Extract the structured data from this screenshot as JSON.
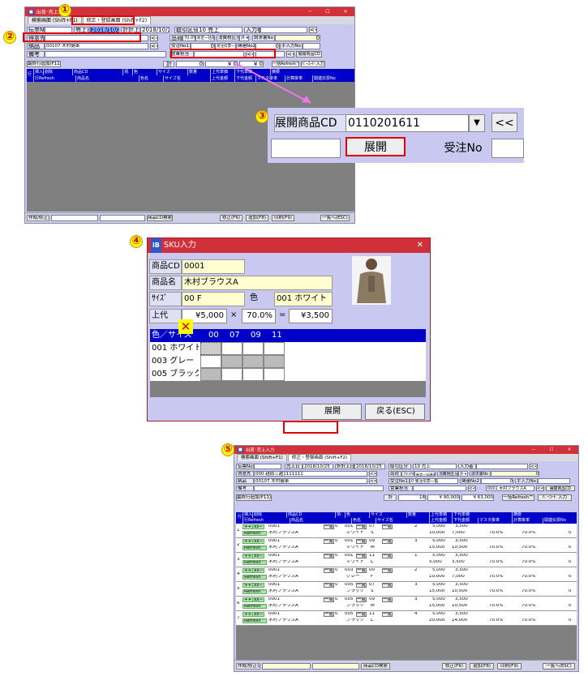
{
  "markers": [
    "①",
    "②",
    "③",
    "④",
    "⑤"
  ],
  "win1": {
    "title": "出荷･売上入力",
    "tabs": [
      "検索画面 (Shift+F1)",
      "修正・登録画面 (Shift+F2)"
    ],
    "fields": {
      "denpyo": "伝票No",
      "uriage_label": "売上日",
      "uriage_val": "2018/10/25",
      "keijo_label": "計計上日",
      "keijo_val": "2018/10/25",
      "torihiki_label": "取引区分",
      "torihiki_val": "10 売上",
      "nyuryoku": "入力者",
      "tokuisaki": "得意先",
      "shukka": "出荷",
      "rate": "70.0%",
      "rate_note": "新定一括基準",
      "shohizei": "消費税区分",
      "shohizei_val": "外 ▾",
      "seikyu": "請求書No",
      "nohin": "納品",
      "nohin_val": "00107 木村健車",
      "juchu": "受注No1",
      "juchu_note": "受注伝票一覧",
      "kanren": "関連No2",
      "tenyuryoku": "手入力No",
      "biko": "備考",
      "eigyo": "営業担当",
      "tenkai_btn": "展開商品CD"
    },
    "toolbar": {
      "add_row": "最終行追加(F11)",
      "total_label": "計",
      "total_qty": "0",
      "total1": "¥ 0",
      "total2": "¥ 0",
      "refresh": "一括Refresh™",
      "barcode": "ﾊﾞｰｺｰﾄﾞ入力"
    },
    "cols_top": [
      "行",
      "挿入",
      "削除",
      "商品CD",
      "項",
      "色",
      "サイズ",
      "数量",
      "上代単価",
      "下代単価",
      "摘要"
    ],
    "cols_bot": [
      "行Refresh",
      "商品名",
      "色名",
      "サイズ名",
      "上代金額",
      "下代金額",
      "マスタ掛率",
      "計算掛率",
      "関連伝票No"
    ],
    "footer": {
      "created": "作成/修正日",
      "search": "商品CD検索",
      "fix": "修正(F6)",
      "add": "追加(F8)",
      "print": "印刷(F9)",
      "list": "一覧へ(ESC)"
    }
  },
  "zoom": {
    "label": "展開商品CD",
    "value": "0110201611",
    "prev": "<<",
    "expand": "展開",
    "order_label": "受注No"
  },
  "sku": {
    "title": "SKU入力",
    "code_label": "商品CD",
    "code": "0001",
    "name_label": "商品名",
    "name": "木村ブラウスA",
    "size_label": "ｻｲｽﾞ",
    "size": "00 F",
    "color_label": "色",
    "color": "001 ホワイト",
    "price_label": "上代",
    "price": "¥5,000",
    "times": "×",
    "rate": "70.0%",
    "eq": "=",
    "result": "¥3,500",
    "grid_head": "色／サイズ",
    "grid_cols": [
      "00",
      "07",
      "09",
      "11"
    ],
    "rows": [
      "001 ホワイト",
      "003 グレー",
      "005 ブラック"
    ],
    "mark": "✕",
    "expand": "展開",
    "back": "戻る(ESC)"
  },
  "win5": {
    "title": "出荷･売上入力",
    "tabs": [
      "検索画面 (Shift+F1)",
      "修正・登録画面 (Shift+F2)"
    ],
    "tokuisaki_val": "000 越前三越1111111",
    "nohin_val": "00107 木村健車",
    "juchu_val": "0 受注伝票一覧",
    "tenkai_val": "0001 木村ブラウスA",
    "total_qty": "18",
    "total1": "¥ 90,000",
    "total2": "¥ 63,000",
    "rows": [
      {
        "no": "1",
        "code": "0001",
        "name": "木村ブラウスA",
        "item": "0",
        "color": "001",
        "colorname": "ホワイト",
        "size": "07",
        "sizename": "S",
        "qty": "2",
        "up": "5,000",
        "down": "3,500",
        "upsum": "10,000",
        "downsum": "7,000",
        "r1": "70.0%",
        "r2": "70.0%",
        "rel": "0"
      },
      {
        "no": "2",
        "code": "0001",
        "name": "木村ブラウスA",
        "item": "0",
        "color": "001",
        "colorname": "ホワイト",
        "size": "09",
        "sizename": "M",
        "qty": "3",
        "up": "5,000",
        "down": "3,500",
        "upsum": "15,000",
        "downsum": "10,500",
        "r1": "70.0%",
        "r2": "70.0%",
        "rel": "0"
      },
      {
        "no": "3",
        "code": "0001",
        "name": "木村ブラウスA",
        "item": "0",
        "color": "001",
        "colorname": "ホワイト",
        "size": "11",
        "sizename": "L",
        "qty": "1",
        "up": "5,000",
        "down": "3,500",
        "upsum": "5,000",
        "downsum": "3,500",
        "r1": "70.0%",
        "r2": "70.0%",
        "rel": "0"
      },
      {
        "no": "4",
        "code": "0001",
        "name": "木村ブラウスA",
        "item": "0",
        "color": "003",
        "colorname": "グレー",
        "size": "00",
        "sizename": "F",
        "qty": "2",
        "up": "5,000",
        "down": "3,500",
        "upsum": "10,000",
        "downsum": "7,000",
        "r1": "70.0%",
        "r2": "70.0%",
        "rel": "0"
      },
      {
        "no": "5",
        "code": "0001",
        "name": "木村ブラウスA",
        "item": "0",
        "color": "005",
        "colorname": "ブラック",
        "size": "07",
        "sizename": "S",
        "qty": "3",
        "up": "5,000",
        "down": "3,500",
        "upsum": "15,000",
        "downsum": "10,500",
        "r1": "70.0%",
        "r2": "70.0%",
        "rel": "0"
      },
      {
        "no": "6",
        "code": "0001",
        "name": "木村ブラウスA",
        "item": "0",
        "color": "005",
        "colorname": "ブラック",
        "size": "09",
        "sizename": "M",
        "qty": "3",
        "up": "5,000",
        "down": "3,500",
        "upsum": "15,000",
        "downsum": "10,500",
        "r1": "70.0%",
        "r2": "70.0%",
        "rel": "0"
      },
      {
        "no": "7",
        "code": "0001",
        "name": "木村ブラウスA",
        "item": "0",
        "color": "005",
        "colorname": "ブラック",
        "size": "11",
        "sizename": "L",
        "qty": "4",
        "up": "5,000",
        "down": "3,500",
        "upsum": "20,000",
        "downsum": "14,000",
        "r1": "70.0%",
        "r2": "70.0%",
        "rel": "0"
      }
    ],
    "ins": "++↑",
    "del": "xx−",
    "refresh": "Refresh™",
    "list": "一覧"
  }
}
